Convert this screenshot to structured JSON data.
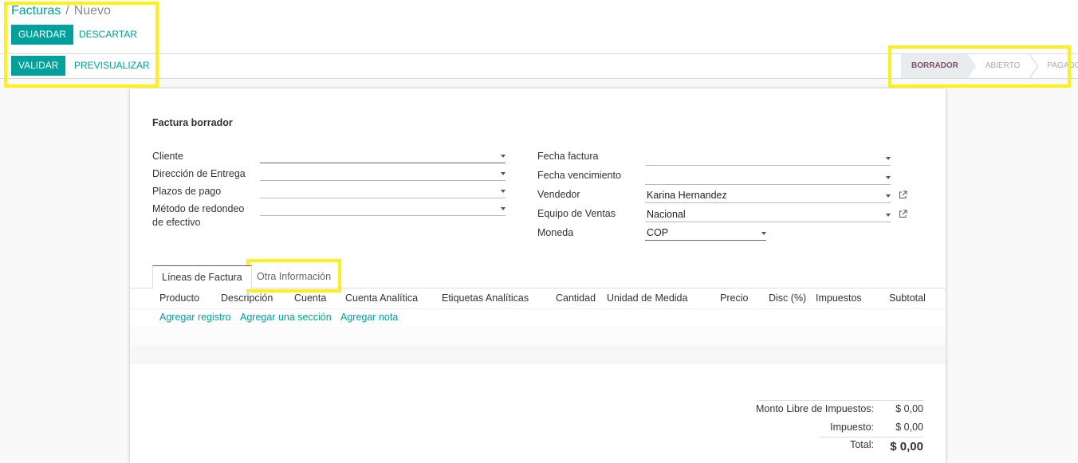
{
  "breadcrumb": {
    "parent": "Facturas",
    "separator": "/",
    "current": "Nuevo"
  },
  "buttons": {
    "save": "GUARDAR",
    "discard": "DESCARTAR",
    "validate": "VALIDAR",
    "preview": "PREVISUALIZAR"
  },
  "status_stages": [
    "BORRADOR",
    "ABIERTO",
    "PAGADO"
  ],
  "status_active": "BORRADOR",
  "form": {
    "title": "Factura borrador",
    "left": [
      {
        "label": "Cliente",
        "value": ""
      },
      {
        "label": "Dirección de Entrega",
        "value": ""
      },
      {
        "label": "Plazos de pago",
        "value": ""
      },
      {
        "label_line1": "Método de redondeo",
        "label_line2": "de efectivo",
        "value": ""
      }
    ],
    "right": [
      {
        "label": "Fecha factura",
        "value": ""
      },
      {
        "label": "Fecha vencimiento",
        "value": ""
      },
      {
        "label": "Vendedor",
        "value": "Karina Hernandez"
      },
      {
        "label": "Equipo de Ventas",
        "value": "Nacional"
      },
      {
        "label": "Moneda",
        "value": "COP"
      }
    ]
  },
  "tabs": [
    "Líneas de Factura",
    "Otra Información"
  ],
  "table": {
    "columns": [
      "Producto",
      "Descripción",
      "Cuenta",
      "Cuenta Analítica",
      "Etiquetas Analíticas",
      "Cantidad",
      "Unidad de Medida",
      "Precio",
      "Disc (%)",
      "Impuestos",
      "Subtotal"
    ],
    "actions": [
      "Agregar registro",
      "Agregar una sección",
      "Agregar nota"
    ]
  },
  "totals": {
    "untaxed_label": "Monto Libre de Impuestos:",
    "untaxed_value": "$ 0,00",
    "tax_label": "Impuesto:",
    "tax_value": "$ 0,00",
    "total_label": "Total:",
    "total_value": "$ 0,00"
  },
  "colors": {
    "accent": "#00a09d",
    "highlight": "#ffef1a",
    "active_stage": "#7c4f6f"
  }
}
